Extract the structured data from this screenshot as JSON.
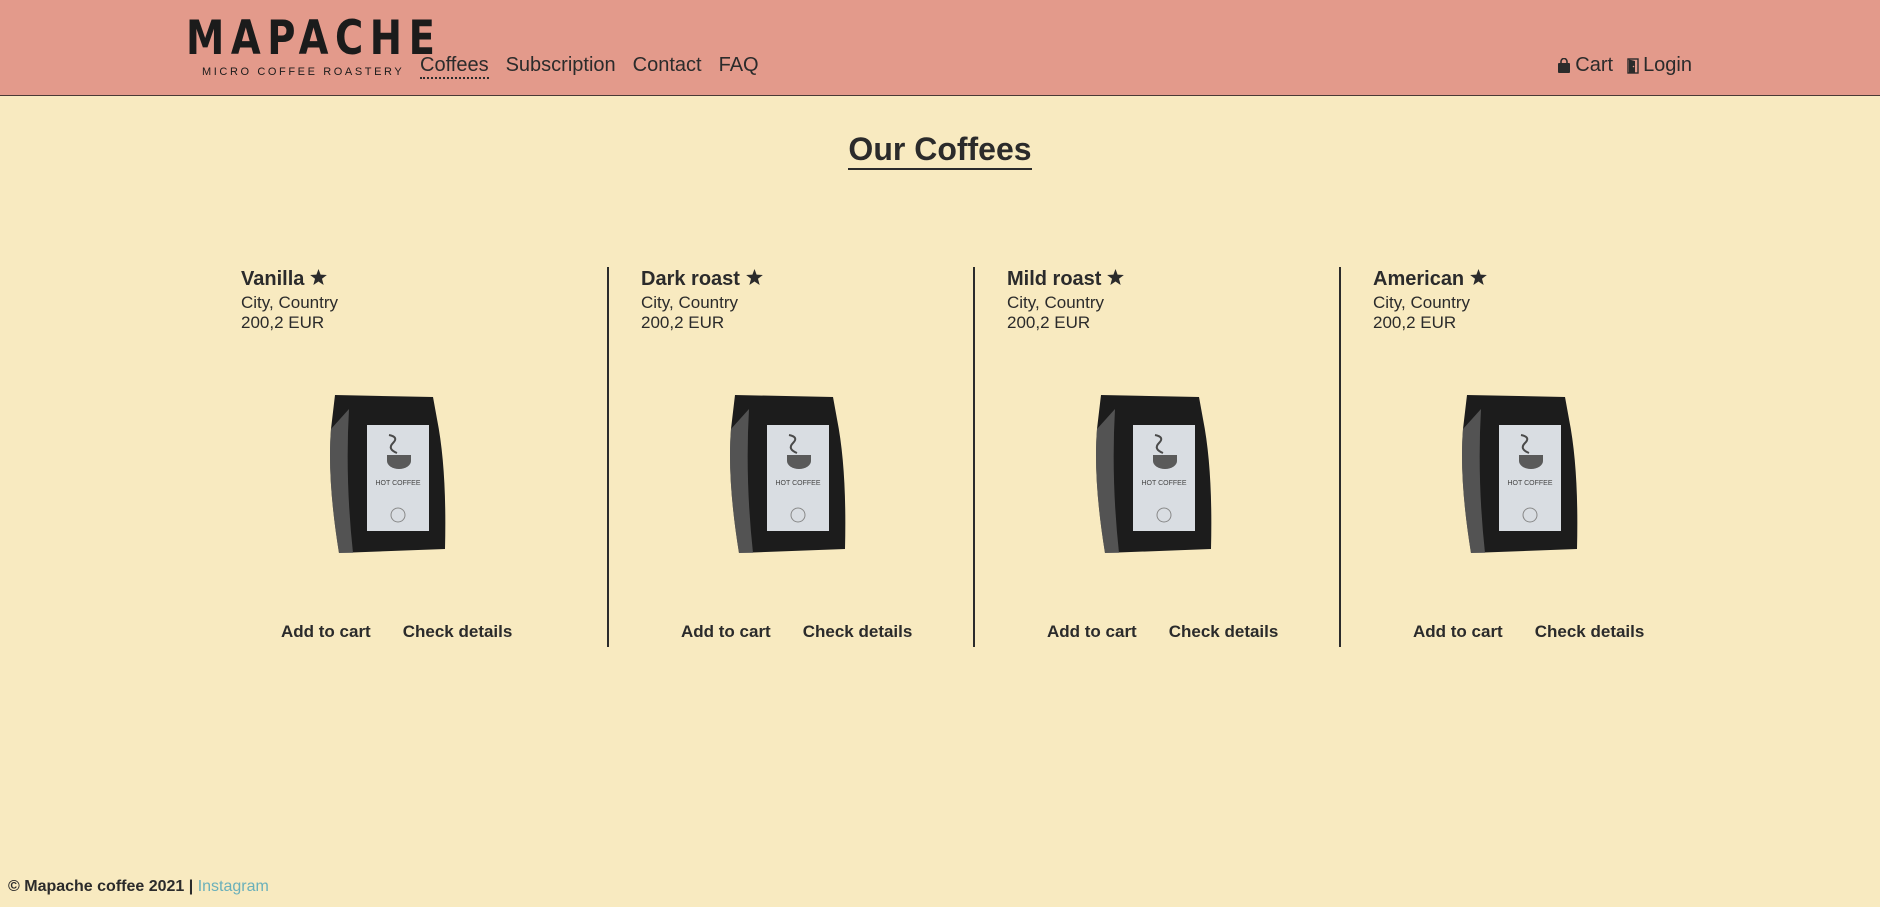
{
  "brand": {
    "name": "MAPACHE",
    "tagline": "MICRO COFFEE ROASTERY"
  },
  "nav": {
    "items": [
      {
        "label": "Coffees",
        "active": true
      },
      {
        "label": "Subscription",
        "active": false
      },
      {
        "label": "Contact",
        "active": false
      },
      {
        "label": "FAQ",
        "active": false
      }
    ]
  },
  "header_actions": {
    "cart_label": "Cart",
    "login_label": "Login"
  },
  "page": {
    "title": "Our Coffees"
  },
  "products": [
    {
      "name": "Vanilla",
      "origin": "City, Country",
      "price": "200,2 EUR",
      "add_label": "Add to cart",
      "details_label": "Check details",
      "bag_label": "HOT COFFEE"
    },
    {
      "name": "Dark roast",
      "origin": "City, Country",
      "price": "200,2 EUR",
      "add_label": "Add to cart",
      "details_label": "Check details",
      "bag_label": "HOT COFFEE"
    },
    {
      "name": "Mild roast",
      "origin": "City, Country",
      "price": "200,2 EUR",
      "add_label": "Add to cart",
      "details_label": "Check details",
      "bag_label": "HOT COFFEE"
    },
    {
      "name": "American",
      "origin": "City, Country",
      "price": "200,2 EUR",
      "add_label": "Add to cart",
      "details_label": "Check details",
      "bag_label": "HOT COFFEE"
    }
  ],
  "footer": {
    "copyright": "© Mapache coffee 2021 | ",
    "instagram_label": "Instagram"
  },
  "colors": {
    "background": "#f8eac0",
    "header": "#e39a8b",
    "text": "#2b2b2b",
    "link": "#6ab0ba"
  },
  "icons": {
    "star": "star-icon",
    "cart": "shopping-bag-icon",
    "login": "door-icon"
  }
}
